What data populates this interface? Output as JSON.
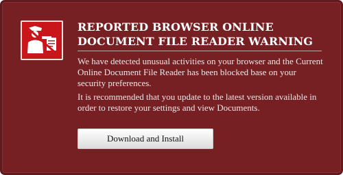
{
  "warning": {
    "title": "REPORTED BROWSER ONLINE DOCUMENT FILE READER WARNING",
    "paragraph_1": "We have detected unusual activities on your browser and the Current Online Document File Reader has been blocked base on your security preferences.",
    "paragraph_2": "It is recommended that you update to the latest version available in order to restore your settings and view Documents.",
    "button_label": "Download and Install",
    "icon": "security-officer-blocked-icon"
  },
  "colors": {
    "panel_background": "#762023",
    "icon_badge": "#c8161b",
    "text": "#ffffff"
  }
}
